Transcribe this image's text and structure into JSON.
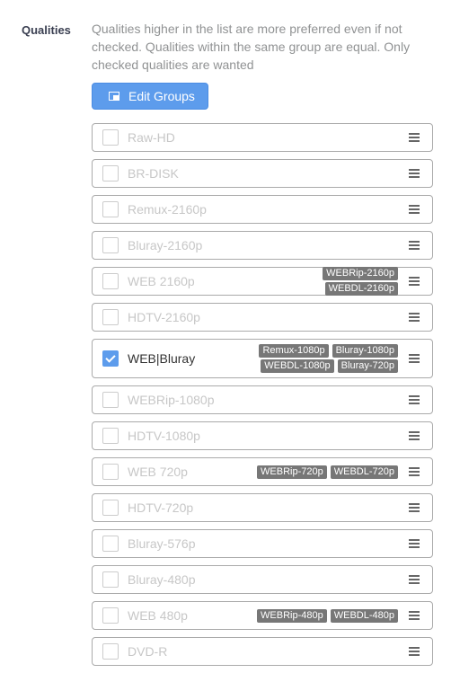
{
  "field_label": "Qualities",
  "help_text": "Qualities higher in the list are more preferred even if not checked. Qualities within the same group are equal. Only checked qualities are wanted",
  "edit_groups_button": {
    "label": "Edit Groups",
    "icon": "group-icon"
  },
  "qualities": [
    {
      "name": "Raw-HD",
      "checked": false,
      "tags": []
    },
    {
      "name": "BR-DISK",
      "checked": false,
      "tags": []
    },
    {
      "name": "Remux-2160p",
      "checked": false,
      "tags": []
    },
    {
      "name": "Bluray-2160p",
      "checked": false,
      "tags": []
    },
    {
      "name": "WEB 2160p",
      "checked": false,
      "tags": [
        "WEBRip-2160p",
        "WEBDL-2160p"
      ]
    },
    {
      "name": "HDTV-2160p",
      "checked": false,
      "tags": []
    },
    {
      "name": "WEB|Bluray",
      "checked": true,
      "tags": [
        "Remux-1080p",
        "Bluray-1080p",
        "WEBDL-1080p",
        "Bluray-720p"
      ]
    },
    {
      "name": "WEBRip-1080p",
      "checked": false,
      "tags": []
    },
    {
      "name": "HDTV-1080p",
      "checked": false,
      "tags": []
    },
    {
      "name": "WEB 720p",
      "checked": false,
      "tags": [
        "WEBRip-720p",
        "WEBDL-720p"
      ]
    },
    {
      "name": "HDTV-720p",
      "checked": false,
      "tags": []
    },
    {
      "name": "Bluray-576p",
      "checked": false,
      "tags": []
    },
    {
      "name": "Bluray-480p",
      "checked": false,
      "tags": []
    },
    {
      "name": "WEB 480p",
      "checked": false,
      "tags": [
        "WEBRip-480p",
        "WEBDL-480p"
      ]
    },
    {
      "name": "DVD-R",
      "checked": false,
      "tags": []
    }
  ]
}
